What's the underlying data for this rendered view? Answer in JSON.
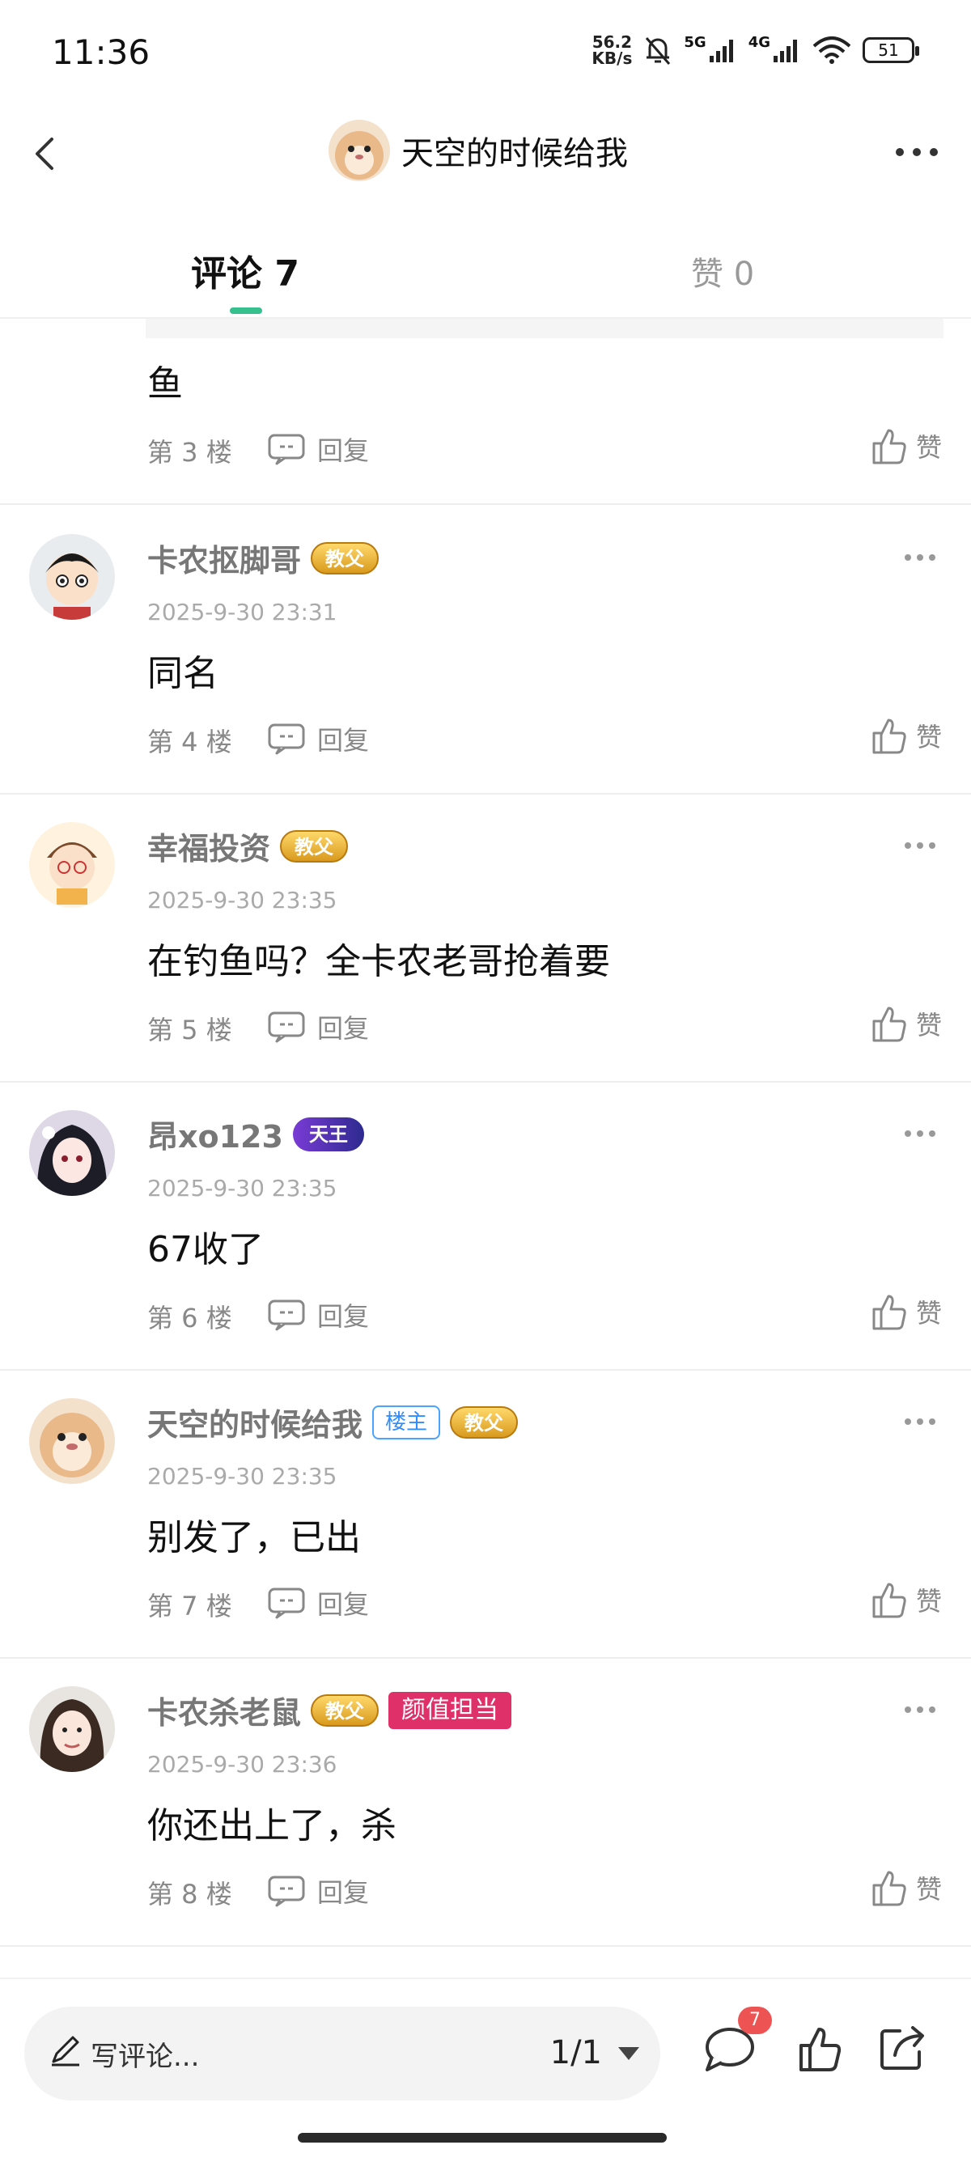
{
  "status": {
    "time": "11:36",
    "net_speed": "56.2",
    "net_unit": "KB/s",
    "sim1": "5G",
    "sim2": "4G",
    "battery": "51"
  },
  "nav": {
    "title": "天空的时候给我"
  },
  "tabs": {
    "comments": "评论 7",
    "likes": "赞 0"
  },
  "comments": [
    {
      "text": "鱼",
      "floor": "第 3 楼",
      "reply": "回复",
      "like": "赞"
    },
    {
      "user": "卡农抠脚哥",
      "badge": "教父",
      "time": "2025-9-30 23:31",
      "text": "同名",
      "floor": "第 4 楼",
      "reply": "回复",
      "like": "赞"
    },
    {
      "user": "幸福投资",
      "badge": "教父",
      "time": "2025-9-30 23:35",
      "text": "在钓鱼吗？全卡农老哥抢着要",
      "floor": "第 5 楼",
      "reply": "回复",
      "like": "赞"
    },
    {
      "user": "昂xo123",
      "badge": "天王",
      "time": "2025-9-30 23:35",
      "text": "67收了",
      "floor": "第 6 楼",
      "reply": "回复",
      "like": "赞"
    },
    {
      "user": "天空的时候给我",
      "owner_badge": "楼主",
      "badge": "教父",
      "time": "2025-9-30 23:35",
      "text": "别发了，已出",
      "floor": "第 7 楼",
      "reply": "回复",
      "like": "赞"
    },
    {
      "user": "卡农杀老鼠",
      "badge": "教父",
      "extra_badge": "颜值担当",
      "time": "2025-9-30 23:36",
      "text": "你还出上了，杀",
      "floor": "第 8 楼",
      "reply": "回复",
      "like": "赞"
    }
  ],
  "bottom": {
    "write_placeholder": "写评论...",
    "page": "1/1",
    "comment_count": "7"
  },
  "colors": {
    "accent": "#36c08e",
    "badge_red": "#ee5353",
    "pretty_badge": "#e0306a"
  }
}
